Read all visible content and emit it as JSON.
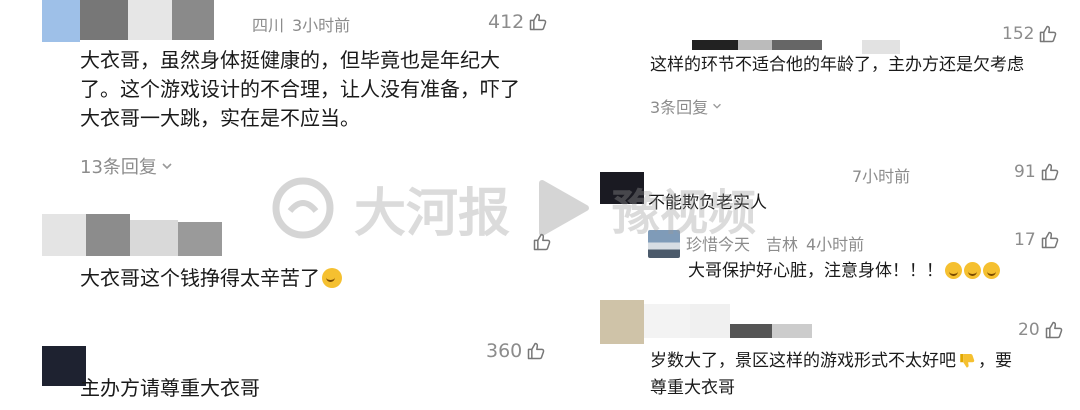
{
  "left": {
    "c1": {
      "location": "四川",
      "time": "3小时前",
      "likes": "412",
      "lines": [
        "大衣哥，虽然身体挺健康的，但毕竟也是年纪大",
        "了。这个游戏设计的不合理，让人没有准备，吓了",
        "大衣哥一大跳，实在是不应当。"
      ],
      "replies": "13条回复"
    },
    "c2": {
      "text": "大衣哥这个钱挣得太辛苦了"
    },
    "c3": {
      "likes": "360",
      "text": "主办方请尊重大衣哥"
    }
  },
  "right": {
    "r1": {
      "likes": "152",
      "text": "这样的环节不适合他的年龄了，主办方还是欠考虑",
      "replies": "3条回复"
    },
    "r2": {
      "time": "7小时前",
      "likes": "91",
      "text": "不能欺负老实人"
    },
    "r3": {
      "username": "珍惜今天",
      "location": "吉林",
      "time": "4小时前",
      "likes": "17",
      "text": "大哥保护好心脏，注意身体！！！"
    },
    "r4": {
      "likes": "20",
      "lines": [
        "岁数大了，景区这样的游戏形式不太好吧",
        "，要",
        "尊重大衣哥"
      ]
    }
  },
  "watermark": {
    "brand1": "大河报",
    "brand2": "豫视频"
  },
  "colors": {
    "text": "#1a1a1a",
    "meta": "#8c8c8c",
    "emoji": "#f5c030"
  },
  "icons": [
    "thumbs-up-icon",
    "chevron-down-icon",
    "crying-laughing-emoji",
    "thumbs-down-emoji"
  ]
}
